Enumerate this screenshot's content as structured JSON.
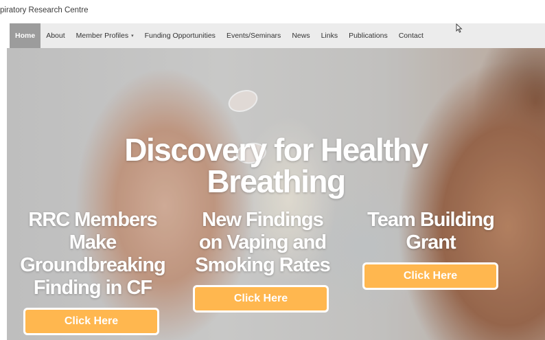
{
  "header": {
    "site_title": "piratory Research Centre"
  },
  "nav": {
    "items": [
      {
        "label": "Home",
        "active": true
      },
      {
        "label": "About"
      },
      {
        "label": "Member Profiles",
        "dropdown": true
      },
      {
        "label": "Funding Opportunities"
      },
      {
        "label": "Events/Seminars"
      },
      {
        "label": "News"
      },
      {
        "label": "Links"
      },
      {
        "label": "Publications"
      },
      {
        "label": "Contact"
      }
    ],
    "caret_glyph": "▾"
  },
  "hero": {
    "headline_line1": "Discovery for Healthy",
    "headline_line2": "Breathing",
    "slides": [
      {
        "heading_lines": [
          "RRC Members",
          "Make",
          "Groundbreaking",
          "Finding in CF"
        ],
        "button": "Click Here"
      },
      {
        "heading_lines": [
          "New Findings",
          "on Vaping and",
          "Smoking Rates"
        ],
        "button": "Click Here"
      },
      {
        "heading_lines": [
          "Team Building",
          "Grant"
        ],
        "button": "Click Here"
      }
    ]
  },
  "colors": {
    "button_bg": "#ffb74f",
    "nav_bg": "#ececec",
    "nav_active_bg": "#9c9c9c"
  },
  "icons": {
    "cursor": "mouse-pointer-icon",
    "caret": "caret-down-icon"
  }
}
